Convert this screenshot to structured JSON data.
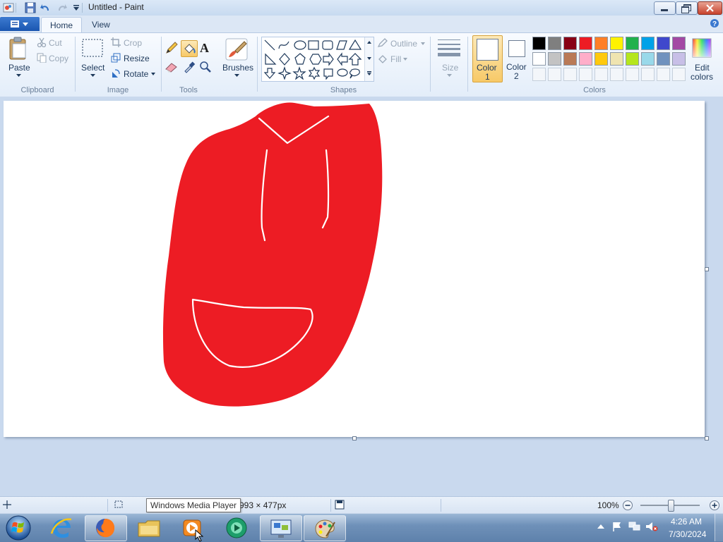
{
  "window": {
    "title": "Untitled - Paint"
  },
  "tabs": [
    {
      "label": "Home"
    },
    {
      "label": "View"
    }
  ],
  "clipboard": {
    "paste": "Paste",
    "cut": "Cut",
    "copy": "Copy",
    "group": "Clipboard"
  },
  "image": {
    "select": "Select",
    "crop": "Crop",
    "resize": "Resize",
    "rotate": "Rotate",
    "group": "Image"
  },
  "tools": {
    "group": "Tools",
    "brushes": "Brushes"
  },
  "shapes": {
    "group": "Shapes",
    "outline": "Outline",
    "fill": "Fill"
  },
  "size": {
    "label": "Size"
  },
  "color1": {
    "line1": "Color",
    "line2": "1"
  },
  "color2": {
    "line1": "Color",
    "line2": "2"
  },
  "colors": {
    "group": "Colors",
    "edit_line1": "Edit",
    "edit_line2": "colors",
    "row1": [
      "#000000",
      "#7f7f7f",
      "#880015",
      "#ed1c24",
      "#ff7f27",
      "#fff200",
      "#22b14c",
      "#00a2e8",
      "#3f48cc",
      "#a349a4"
    ],
    "row2": [
      "#ffffff",
      "#c3c3c3",
      "#b97a57",
      "#ffaec9",
      "#ffc90e",
      "#efe4b0",
      "#b5e61d",
      "#99d9ea",
      "#7092be",
      "#c8bfe7"
    ]
  },
  "drawing": {
    "fill_color": "#ed1c24",
    "stroke_color": "#ffffff"
  },
  "status": {
    "dimensions": "993 × 477px",
    "zoom": "100%"
  },
  "tooltip": {
    "text": "Windows Media Player"
  },
  "tray": {
    "time": "4:26 AM",
    "date": "7/30/2024"
  }
}
